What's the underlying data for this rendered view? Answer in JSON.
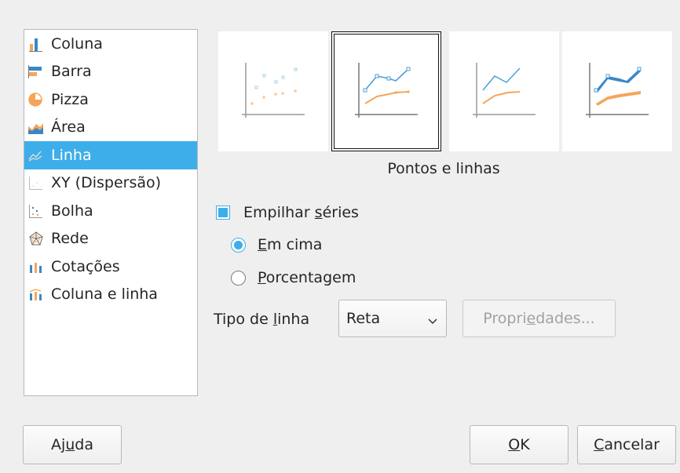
{
  "chart_types": [
    {
      "label": "Coluna",
      "icon": "column-chart-icon"
    },
    {
      "label": "Barra",
      "icon": "bar-chart-icon"
    },
    {
      "label": "Pizza",
      "icon": "pie-chart-icon"
    },
    {
      "label": "Área",
      "icon": "area-chart-icon"
    },
    {
      "label": "Linha",
      "icon": "line-chart-icon"
    },
    {
      "label": "XY (Dispersão)",
      "icon": "xy-scatter-chart-icon"
    },
    {
      "label": "Bolha",
      "icon": "bubble-chart-icon"
    },
    {
      "label": "Rede",
      "icon": "net-chart-icon"
    },
    {
      "label": "Cotações",
      "icon": "stock-chart-icon"
    },
    {
      "label": "Coluna e linha",
      "icon": "column-and-line-chart-icon"
    }
  ],
  "selected_type": "Linha",
  "variant_caption": "Pontos e linhas",
  "options": {
    "stack_series_pre": "Empilhar ",
    "stack_series_u": "s",
    "stack_series_post": "éries",
    "stack_checked": true,
    "on_top_u": "E",
    "on_top_post": "m cima",
    "percent_u": "P",
    "percent_post": "orcentagem",
    "line_type_pre": "Tipo de ",
    "line_type_u": "l",
    "line_type_post": "inha",
    "line_type_value": "Reta",
    "properties_pre": "Propri",
    "properties_u": "e",
    "properties_post": "dades..."
  },
  "buttons": {
    "help_pre": "Aj",
    "help_u": "u",
    "help_post": "da",
    "ok_u": "O",
    "ok_post": "K",
    "cancel_u": "C",
    "cancel_post": "ancelar"
  },
  "colors": {
    "accent": "#3daee9",
    "series_blue": "#4a9fd8",
    "series_orange": "#f4a55a"
  }
}
